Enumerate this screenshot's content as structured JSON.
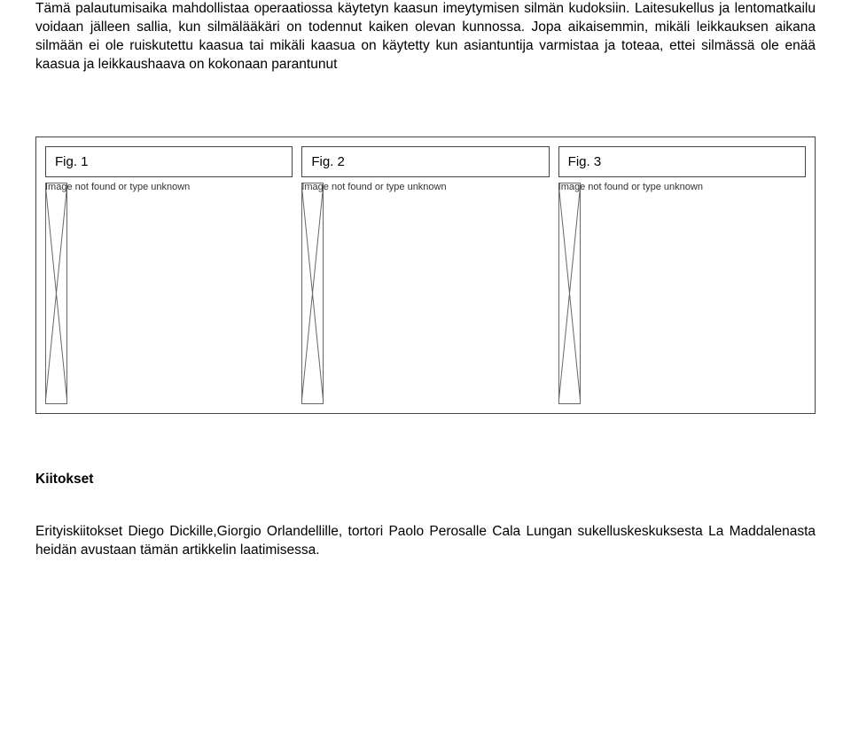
{
  "paragraph1": "Tämä palautumisaika mahdollistaa operaatiossa käytetyn kaasun imeytymisen silmän kudoksiin. Laitesukellus ja lentomatkailu voidaan jälleen sallia, kun silmälääkäri on todennut kaiken olevan kunnossa. Jopa aikaisemmin, mikäli leikkauksen aikana silmään ei ole ruiskutettu kaasua tai mikäli kaasua on käytetty kun asiantuntija varmistaa ja toteaa, ettei silmässä ole enää kaasua ja leikkaushaava on kokonaan parantunut",
  "figures": [
    {
      "caption": "Fig. 1",
      "alt": "Image not found or type unknown"
    },
    {
      "caption": "Fig. 2",
      "alt": "Image not found or type unknown"
    },
    {
      "caption": "Fig. 3",
      "alt": "Image not found or type unknown"
    }
  ],
  "ack_heading": "Kiitokset",
  "ack_paragraph": "Erityiskiitokset Diego Dickille,Giorgio Orlandellille, tortori Paolo Perosalle Cala Lungan sukelluskeskuksesta La Maddalenasta heidän avustaan tämän artikkelin laatimisessa."
}
